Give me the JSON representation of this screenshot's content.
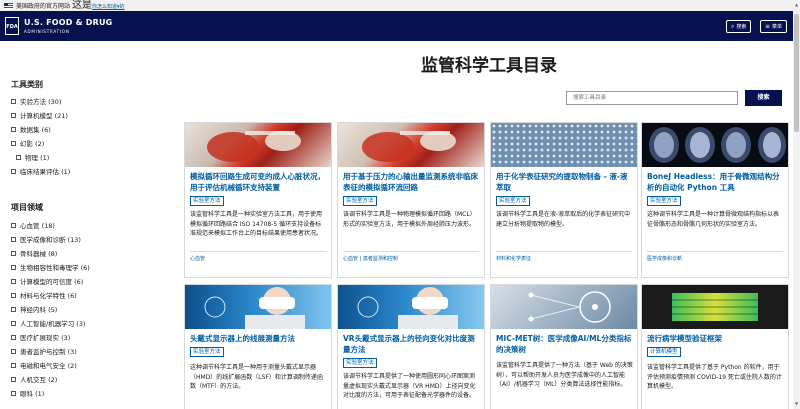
{
  "gov_banner": {
    "text": "美国政府的官方网站",
    "big": "这是",
    "link": "你怎么知道▾的"
  },
  "header": {
    "logo": "FDA",
    "brand_main": "U.S. FOOD & DRUG",
    "brand_sub": "ADMINISTRATION",
    "search_label": "搜索",
    "menu_label": "菜单"
  },
  "page_title": "监管科学工具目录",
  "search": {
    "placeholder": "搜索工具目录",
    "button_label": "搜索"
  },
  "sidebar": {
    "tool_types_title": "工具类别",
    "tool_types": [
      {
        "label": "实验方法",
        "count": "(30)"
      },
      {
        "label": "计算机模型",
        "count": "(21)"
      },
      {
        "label": "数据集",
        "count": "(6)"
      },
      {
        "label": "幻影",
        "count": "(2)"
      },
      {
        "label": "物理",
        "count": "(1)"
      },
      {
        "label": "临床结果评估",
        "count": "(1)"
      }
    ],
    "areas_title": "项目领域",
    "areas": [
      {
        "label": "心血管",
        "count": "(18)"
      },
      {
        "label": "医学成像和诊断",
        "count": "(13)"
      },
      {
        "label": "骨科器械",
        "count": "(8)"
      },
      {
        "label": "生物相容性和毒理学",
        "count": "(6)"
      },
      {
        "label": "计算模型的可信度",
        "count": "(6)"
      },
      {
        "label": "材料与化学特性",
        "count": "(6)"
      },
      {
        "label": "神经内科",
        "count": "(5)"
      },
      {
        "label": "人工智能/机器学习",
        "count": "(3)"
      },
      {
        "label": "医疗扩展现实",
        "count": "(3)"
      },
      {
        "label": "患者监护与控制",
        "count": "(3)"
      },
      {
        "label": "电磁和电气安全",
        "count": "(2)"
      },
      {
        "label": "人机交互",
        "count": "(2)"
      },
      {
        "label": "眼科",
        "count": "(1)"
      }
    ]
  },
  "cards": [
    {
      "title": "模拟循环回路生成可变的成人心脏状况，用于评估机械循环支持装置",
      "tag": "实验室方法",
      "desc": "该监管科学工具是一种实验室方法工具，用于使用模拟循环回路结合 ISO 14708-5 循环支持设备标准规范来模拟工作台上的目标结果使用患者状况。",
      "foot": "心血管"
    },
    {
      "title": "用于基于压力的心输出量监测系统非临床表征的模拟循环流回路",
      "tag": "实验室方法",
      "desc": "该调节科学工具是一种物理模拟循环回路（MCL）形式的实验室方法，用于模拟外周经肺压力波形。",
      "foot": "心血管 | 患者监测和控制"
    },
    {
      "title": "用于化学表征研究的提取物制备 - 液-液萃取",
      "tag": "实验室方法",
      "desc": "该调节科学工具是在液-液萃取后的化学表征研究中建立分析物提取物的模型。",
      "foot": "材料和化学表征"
    },
    {
      "title": "BoneJ Headless：用于骨微观结构分析的自动化 Python 工具",
      "tag": "实验室方法",
      "desc": "这种调节科学工具是一种计算骨微观结构指标以表征骨骼形态和骨骼几何形状的实验室方法。",
      "foot": "医学成像和诊断"
    },
    {
      "title": "头戴式显示器上的线展测量方法",
      "tag": "实验室方法",
      "desc": "这种调节科学工具是一种用于测量头戴式显示器（HMD）的线扩展函数（LSF）和计算调制传递函数（MTF）的方法。",
      "foot": ""
    },
    {
      "title": "VR头戴式显示器上的径向变化对比度测量方法",
      "tag": "实验室方法",
      "desc": "该调节科学工具提供了一种使用圆形同心环图案测量虚拟现实头戴式显示器（VR HMD）上径向变化对比度的方法，可用于表征配备光学器件的设备。",
      "foot": ""
    },
    {
      "title": "MIC-MET树：医学成像AI/ML分类指标的决策树",
      "tag": "实验室方法",
      "desc": "该监管科学工具提供了一种方法（基于 Web 的决策树），可以帮助开发人员为医学成像中的人工智能（AI）/机器学习（ML）分类算法选择性能指标。",
      "foot": ""
    },
    {
      "title": "流行病学模型验证框架",
      "tag": "计算机模型",
      "desc": "该监管科学工具提供了基于 Python 的软件，用于评估预测疫情预测 COVID-19 死亡或住院人数的计算机模型。",
      "foot": ""
    }
  ]
}
